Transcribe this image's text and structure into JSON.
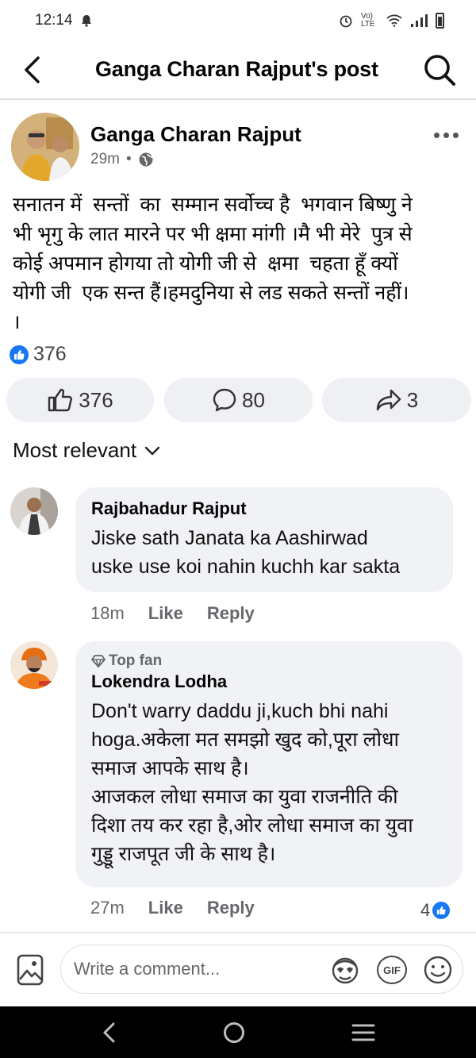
{
  "status_bar": {
    "time": "12:14",
    "network_label": "Vo) LTE"
  },
  "header": {
    "title": "Ganga Charan Rajput's post"
  },
  "post": {
    "author": "Ganga Charan Rajput",
    "time_ago": "29m",
    "separator": "•",
    "text": "सनातन में  सन्तों  का  सम्मान सर्वोच्च है  भगवान बिष्णु ने\nभी भृगु के लात मारने पर भी क्षमा मांगी ।मै भी मेरे  पुत्र से\nकोई अपमान होगया तो योगी जी से  क्षमा  चहता हूॅं क्यों\nयोगी जी  एक सन्त हैं।हमदुनिया से लड सकते सन्तों नहीं।\n।",
    "reaction_total": "376",
    "like_count": "376",
    "comment_count": "80",
    "share_count": "3"
  },
  "sort_label": "Most relevant",
  "comments": [
    {
      "name": "Rajbahadur Rajput",
      "text": "Jiske sath Janata ka Aashirwad\nuske use koi nahin kuchh kar sakta",
      "time": "18m",
      "like": "Like",
      "reply": "Reply"
    },
    {
      "badge": "Top fan",
      "name": "Lokendra Lodha",
      "text": "Don't warry daddu ji,kuch bhi nahi\nhoga.अकेला मत समझो खुद को,पूरा लोधा\nसमाज आपके साथ है।\nआजकल लोधा समाज का युवा राजनीति की\nदिशा तय कर रहा है,ओर लोधा समाज का युवा\nगुड्डू राजपूत जी के साथ है।",
      "time": "27m",
      "like": "Like",
      "reply": "Reply",
      "reaction_count": "4"
    }
  ],
  "composer": {
    "placeholder": "Write a comment...",
    "gif_label": "GIF"
  },
  "colors": {
    "accent": "#1877f2",
    "bubble": "#f0f2f5",
    "secondary_text": "#65676b"
  }
}
